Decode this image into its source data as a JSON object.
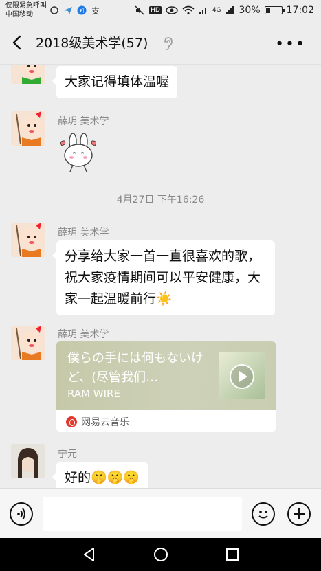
{
  "status_bar": {
    "carrier_line1": "仅限紧急呼叫",
    "carrier_line2": "中国移动",
    "battery_pct": "30%",
    "battery_level": 0.3,
    "time": "17:02",
    "network_label": "4G",
    "hd_label": "HD"
  },
  "header": {
    "title": "2018级美术学(57)"
  },
  "messages": [
    {
      "text": "大家记得填体温喔"
    },
    {
      "sender": "薛玥   美术学",
      "sticker": "bunny-sticker"
    },
    {
      "timestamp": "4月27日 下午16:26"
    },
    {
      "sender": "薛玥   美术学",
      "text": "分享给大家一首一直很喜欢的歌，祝大家疫情期间可以平安健康，大家一起温暖前行☀️"
    },
    {
      "sender": "薛玥   美术学",
      "music": {
        "title": "僕らの手には何もないけど、(尽管我们…",
        "artist": "RAM WIRE",
        "source": "网易云音乐"
      }
    },
    {
      "sender": "宁元",
      "text": "好的🤫🤫🤫"
    }
  ],
  "input": {
    "placeholder": ""
  },
  "colors": {
    "background": "#ededed",
    "bubble": "#ffffff",
    "netease_red": "#e03a2f"
  }
}
